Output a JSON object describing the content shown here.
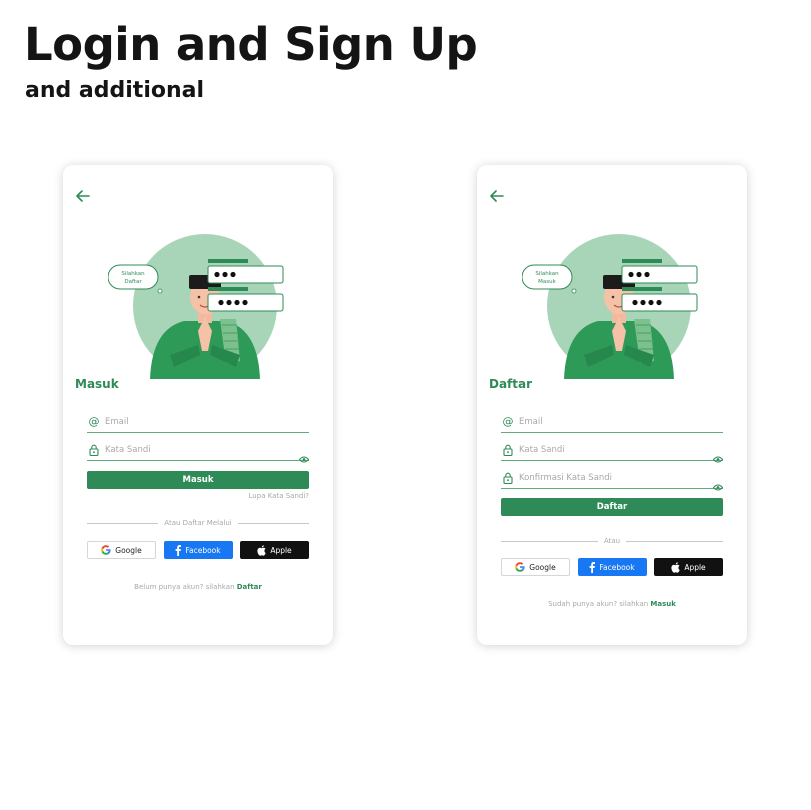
{
  "header": {
    "title": "Login and Sign Up",
    "subtitle": "and additional"
  },
  "colors": {
    "accent": "#2e8b57",
    "facebook": "#1877f2",
    "apple": "#111111",
    "illustration_bg": "#a8d5b8"
  },
  "login": {
    "bubble_text": "Silahkan Daftar",
    "title": "Masuk",
    "email_placeholder": "Email",
    "password_placeholder": "Kata Sandi",
    "submit_label": "Masuk",
    "forgot_label": "Lupa Kata Sandi?",
    "divider_label": "Atau Daftar Melalui",
    "social": {
      "google": "Google",
      "facebook": "Facebook",
      "apple": "Apple"
    },
    "footer_prompt": "Belum punya akun? silahkan",
    "footer_link": "Daftar"
  },
  "signup": {
    "bubble_text": "Silahkan Masuk",
    "title": "Daftar",
    "email_placeholder": "Email",
    "password_placeholder": "Kata Sandi",
    "confirm_placeholder": "Konfirmasi Kata Sandi",
    "submit_label": "Daftar",
    "divider_label": "Atau",
    "social": {
      "google": "Google",
      "facebook": "Facebook",
      "apple": "Apple"
    },
    "footer_prompt": "Sudah punya akun? silahkan",
    "footer_link": "Masuk"
  },
  "icons": {
    "back": "arrow-left-icon",
    "email": "at-sign-icon",
    "password": "padlock-icon",
    "eye": "eye-icon",
    "google": "google-logo-icon",
    "facebook": "facebook-logo-icon",
    "apple": "apple-logo-icon"
  }
}
